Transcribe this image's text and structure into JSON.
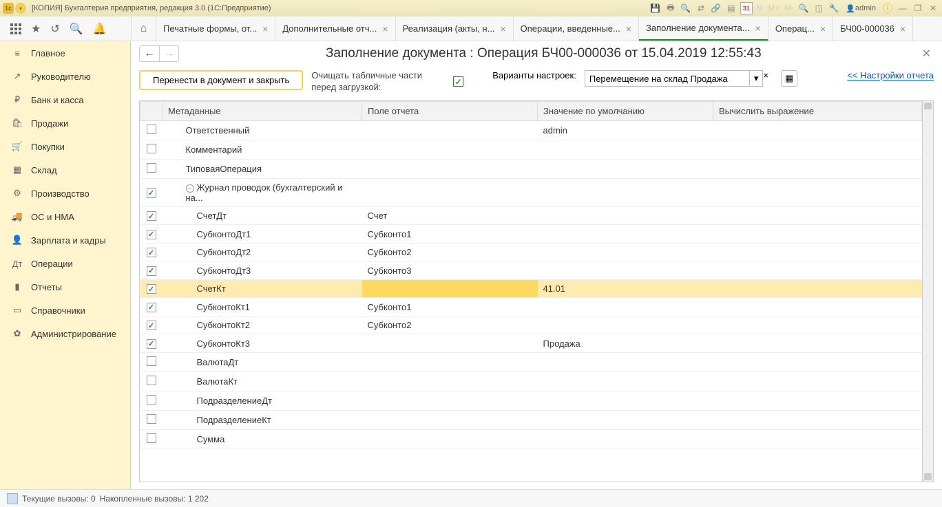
{
  "titlebar": {
    "title": "[КОПИЯ] Бухгалтерия предприятия, редакция 3.0  (1С:Предприятие)",
    "mem_m": "M",
    "mem_mp": "M+",
    "mem_mm": "M-",
    "calendar": "31",
    "user": "admin"
  },
  "tabs": {
    "items": [
      {
        "label": "Печатные формы, от..."
      },
      {
        "label": "Дополнительные отч..."
      },
      {
        "label": "Реализация (акты, н..."
      },
      {
        "label": "Операции, введенные..."
      },
      {
        "label": "Заполнение документа..."
      },
      {
        "label": "Операц..."
      },
      {
        "label": "БЧ00-000036"
      }
    ]
  },
  "sidebar": {
    "items": [
      {
        "label": "Главное",
        "icon": "≡"
      },
      {
        "label": "Руководителю",
        "icon": "↗"
      },
      {
        "label": "Банк и касса",
        "icon": "₽"
      },
      {
        "label": "Продажи",
        "icon": "🛍"
      },
      {
        "label": "Покупки",
        "icon": "🛒"
      },
      {
        "label": "Склад",
        "icon": "▦"
      },
      {
        "label": "Производство",
        "icon": "⚙"
      },
      {
        "label": "ОС и НМА",
        "icon": "🚚"
      },
      {
        "label": "Зарплата и кадры",
        "icon": "👤"
      },
      {
        "label": "Операции",
        "icon": "Дт"
      },
      {
        "label": "Отчеты",
        "icon": "▮"
      },
      {
        "label": "Справочники",
        "icon": "▭"
      },
      {
        "label": "Администрирование",
        "icon": "✿"
      }
    ]
  },
  "content": {
    "title": "Заполнение документа : Операция БЧ00-000036 от 15.04.2019 12:55:43",
    "main_button": "Перенести в документ и закрыть",
    "clear_label": "Очищать табличные части перед загрузкой:",
    "variant_label": "Варианты настроек:",
    "variant_value": "Перемещение на склад Продажа",
    "settings_link": "<< Настройки отчета"
  },
  "table": {
    "headers": {
      "meta": "Метаданные",
      "pole": "Поле  отчета",
      "default": "Значение по умолчанию",
      "calc": "Вычислить выражение"
    },
    "rows": [
      {
        "checked": false,
        "indent": 2,
        "meta": "Ответственный",
        "pole": "",
        "default": "admin",
        "selected": false
      },
      {
        "checked": false,
        "indent": 2,
        "meta": "Комментарий",
        "pole": "",
        "default": "",
        "selected": false
      },
      {
        "checked": false,
        "indent": 2,
        "meta": "ТиповаяОперация",
        "pole": "",
        "default": "",
        "selected": false
      },
      {
        "checked": true,
        "indent": 2,
        "meta": "Журнал проводок (бухгалтерский и на...",
        "pole": "",
        "default": "",
        "selected": false,
        "toggle": true
      },
      {
        "checked": true,
        "indent": 3,
        "meta": "СчетДт",
        "pole": "Счет",
        "default": "",
        "selected": false
      },
      {
        "checked": true,
        "indent": 3,
        "meta": "СубконтоДт1",
        "pole": "Субконто1",
        "default": "",
        "selected": false
      },
      {
        "checked": true,
        "indent": 3,
        "meta": "СубконтоДт2",
        "pole": "Субконто2",
        "default": "",
        "selected": false
      },
      {
        "checked": true,
        "indent": 3,
        "meta": "СубконтоДт3",
        "pole": "Субконто3",
        "default": "",
        "selected": false
      },
      {
        "checked": true,
        "indent": 3,
        "meta": "СчетКт",
        "pole": "",
        "default": "41.01",
        "selected": true
      },
      {
        "checked": true,
        "indent": 3,
        "meta": "СубконтоКт1",
        "pole": "Субконто1",
        "default": "",
        "selected": false
      },
      {
        "checked": true,
        "indent": 3,
        "meta": "СубконтоКт2",
        "pole": "Субконто2",
        "default": "",
        "selected": false
      },
      {
        "checked": true,
        "indent": 3,
        "meta": "СубконтоКт3",
        "pole": "",
        "default": "Продажа",
        "selected": false
      },
      {
        "checked": false,
        "indent": 3,
        "meta": "ВалютаДт",
        "pole": "",
        "default": "",
        "selected": false
      },
      {
        "checked": false,
        "indent": 3,
        "meta": "ВалютаКт",
        "pole": "",
        "default": "",
        "selected": false
      },
      {
        "checked": false,
        "indent": 3,
        "meta": "ПодразделениеДт",
        "pole": "",
        "default": "",
        "selected": false
      },
      {
        "checked": false,
        "indent": 3,
        "meta": "ПодразделениеКт",
        "pole": "",
        "default": "",
        "selected": false
      },
      {
        "checked": false,
        "indent": 3,
        "meta": "Сумма",
        "pole": "",
        "default": "",
        "selected": false
      }
    ]
  },
  "statusbar": {
    "current": "Текущие вызовы: 0",
    "accum": "Накопленные вызовы: 1 202"
  }
}
